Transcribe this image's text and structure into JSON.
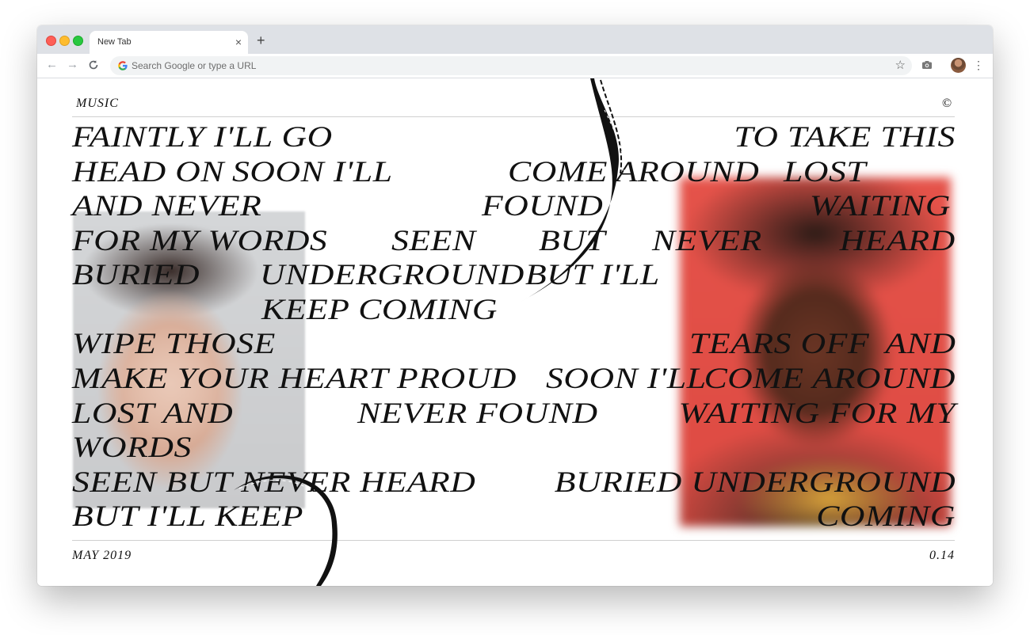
{
  "browser": {
    "tab_title": "New Tab",
    "tab_close": "×",
    "new_tab": "+",
    "omnibox_placeholder": "Search Google or type a URL",
    "icons": [
      "back-icon",
      "forward-icon",
      "reload-icon",
      "google-icon",
      "star-icon",
      "camera-icon",
      "avatar",
      "menu-icon"
    ],
    "glyphs": {
      "back": "←",
      "forward": "→",
      "reload": "C",
      "star": "☆",
      "menu": "⋮"
    }
  },
  "page": {
    "top_left_label": "MUSIC",
    "top_right_label": "©",
    "bottom_left_label": "MAY 2019",
    "bottom_right_label": "0.14",
    "accent_color": "#e5534a",
    "lyrics": [
      "FAINTLY I'LL GO",
      "TO TAKE THIS",
      "HEAD ON",
      "SOON I'LL",
      "COME AROUND",
      "LOST",
      "AND NEVER",
      "FOUND",
      "WAITING",
      "FOR MY WORDS",
      "SEEN",
      "BUT",
      "NEVER",
      "HEARD",
      "BURIED",
      "UNDERGROUND",
      "BUT I'LL",
      "KEEP COMING",
      "WIPE THOSE",
      "TEARS OFF",
      "AND",
      "MAKE YOUR HEART PROUD",
      "SOON I'LL",
      "COME AROUND",
      "LOST AND",
      "NEVER FOUND",
      "WAITING FOR MY",
      "WORDS",
      "SEEN BUT NEVER HEARD",
      "BURIED UNDERGROUND",
      "BUT I'LL KEEP",
      "COMING"
    ]
  }
}
